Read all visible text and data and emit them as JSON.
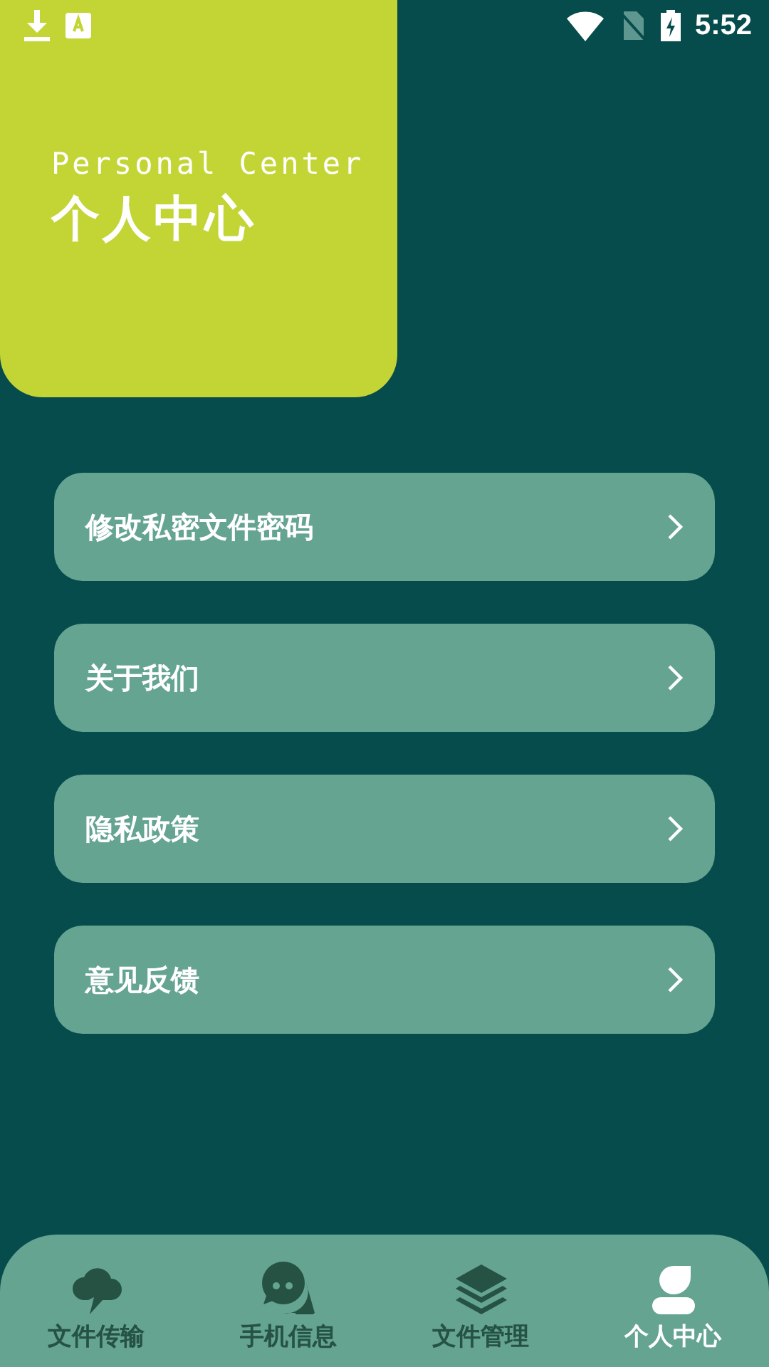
{
  "status_bar": {
    "time": "5:52"
  },
  "header": {
    "subtitle": "Personal Center",
    "title": "个人中心"
  },
  "menu": [
    {
      "label": "修改私密文件密码"
    },
    {
      "label": "关于我们"
    },
    {
      "label": "隐私政策"
    },
    {
      "label": "意见反馈"
    }
  ],
  "tabs": [
    {
      "label": "文件传输",
      "kind": "cloud",
      "selected": false
    },
    {
      "label": "手机信息",
      "kind": "chat",
      "selected": false
    },
    {
      "label": "文件管理",
      "kind": "layers",
      "selected": false
    },
    {
      "label": "个人中心",
      "kind": "person",
      "selected": true
    }
  ]
}
